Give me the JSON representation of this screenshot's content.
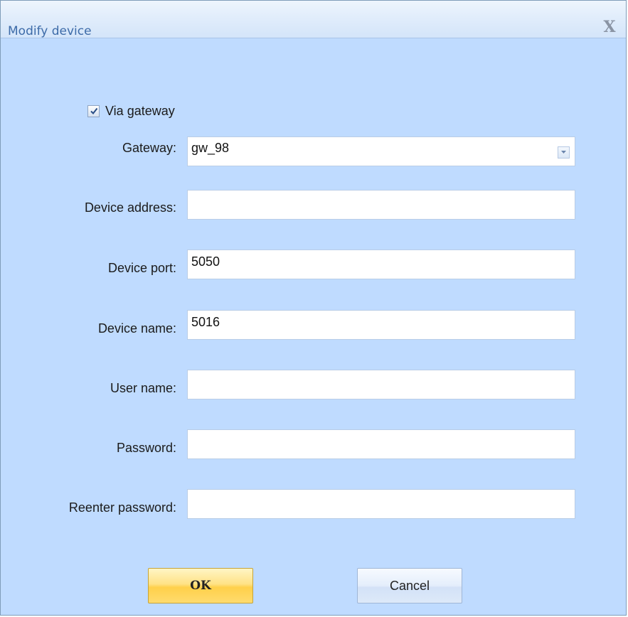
{
  "dialog": {
    "title": "Modify device",
    "close_glyph": "X"
  },
  "via_gateway": {
    "label": "Via gateway",
    "checked": true
  },
  "fields": {
    "gateway": {
      "label": "Gateway:",
      "value": "gw_98"
    },
    "device_address": {
      "label": "Device address:",
      "value": ""
    },
    "device_port": {
      "label": "Device port:",
      "value": "5050"
    },
    "device_name": {
      "label": "Device name:",
      "value": "5016"
    },
    "user_name": {
      "label": "User name:",
      "value": ""
    },
    "password": {
      "label": "Password:",
      "value": ""
    },
    "reenter_password": {
      "label": "Reenter password:",
      "value": ""
    }
  },
  "buttons": {
    "ok": "OK",
    "cancel": "Cancel"
  },
  "icons": {
    "close": "close-icon",
    "checkbox": "check-icon",
    "dropdown": "chevron-down-icon"
  }
}
